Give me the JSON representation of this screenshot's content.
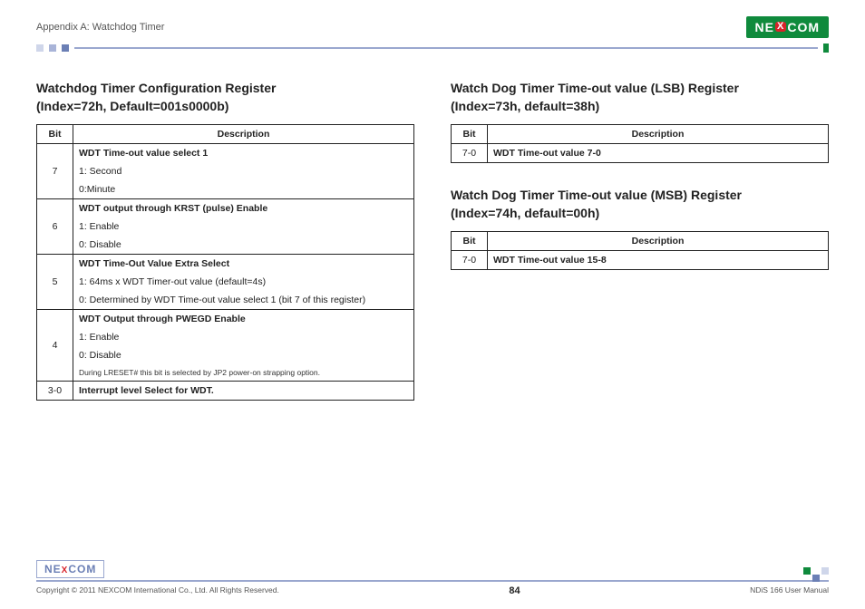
{
  "header": {
    "appendix": "Appendix A: Watchdog Timer",
    "logo_left": "NE",
    "logo_mid": "X",
    "logo_right": "COM"
  },
  "left": {
    "title_line1": "Watchdog Timer Configuration Register",
    "title_line2": "(Index=72h, Default=001s0000b)",
    "th_bit": "Bit",
    "th_desc": "Description",
    "r7_bit": "7",
    "r7_head": "WDT Time-out value select 1",
    "r7_a": "1: Second",
    "r7_b": "0:Minute",
    "r6_bit": "6",
    "r6_head": "WDT output through KRST (pulse) Enable",
    "r6_a": "1: Enable",
    "r6_b": "0: Disable",
    "r5_bit": "5",
    "r5_head": "WDT Time-Out Value Extra Select",
    "r5_a": "1: 64ms x WDT Timer-out value (default=4s)",
    "r5_b": "0: Determined by WDT Time-out value select 1 (bit 7 of this register)",
    "r4_bit": "4",
    "r4_head": "WDT Output through PWEGD Enable",
    "r4_a": "1: Enable",
    "r4_b": "0: Disable",
    "r4_note": "During LRESET# this bit is selected by JP2 power-on strapping option.",
    "r30_bit": "3-0",
    "r30_head": "Interrupt level Select for WDT."
  },
  "right1": {
    "title_line1": "Watch Dog Timer Time-out value (LSB) Register",
    "title_line2": "(Index=73h, default=38h)",
    "th_bit": "Bit",
    "th_desc": "Description",
    "bit": "7-0",
    "desc": "WDT Time-out value 7-0"
  },
  "right2": {
    "title_line1": "Watch Dog Timer Time-out value (MSB) Register",
    "title_line2": "(Index=74h, default=00h)",
    "th_bit": "Bit",
    "th_desc": "Description",
    "bit": "7-0",
    "desc": "WDT Time-out value 15-8"
  },
  "footer": {
    "logo_left": "NE",
    "logo_mid": "X",
    "logo_right": "COM",
    "copyright": "Copyright © 2011 NEXCOM International Co., Ltd. All Rights Reserved.",
    "page": "84",
    "manual": "NDiS 166 User Manual"
  }
}
